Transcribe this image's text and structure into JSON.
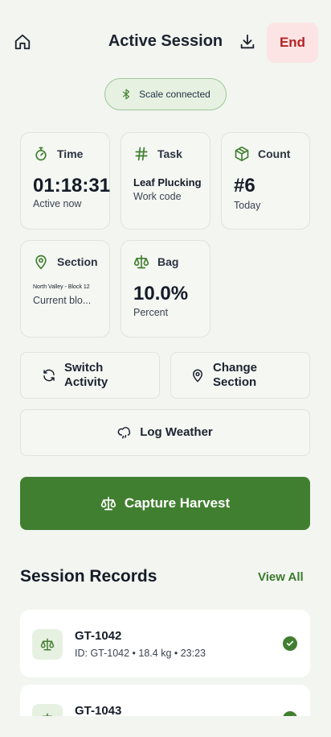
{
  "header": {
    "title": "Active Session",
    "end_label": "End"
  },
  "status": {
    "scale_label": "Scale connected"
  },
  "cards": {
    "time": {
      "label": "Time",
      "value": "01:18:31",
      "sub": "Active now"
    },
    "task": {
      "label": "Task",
      "value": "Leaf Plucking",
      "sub": "Work code"
    },
    "count": {
      "label": "Count",
      "value": "#6",
      "sub": "Today"
    },
    "section": {
      "label": "Section",
      "value": "North Valley - Block 12",
      "sub": "Current blo..."
    },
    "bag": {
      "label": "Bag",
      "value": "10.0%",
      "sub": "Percent"
    }
  },
  "actions": {
    "switch_line1": "Switch",
    "switch_line2": "Activity",
    "change_line1": "Change",
    "change_line2": "Section",
    "weather": "Log Weather",
    "capture": "Capture Harvest"
  },
  "records": {
    "title": "Session Records",
    "view_all": "View All",
    "items": [
      {
        "id": "GT-1042",
        "desc": "ID: GT-1042 • 18.4 kg • 23:23"
      },
      {
        "id": "GT-1043",
        "desc": ""
      }
    ]
  },
  "colors": {
    "accent": "#417f30",
    "danger": "#b52323",
    "danger_bg": "#fde4e4"
  }
}
